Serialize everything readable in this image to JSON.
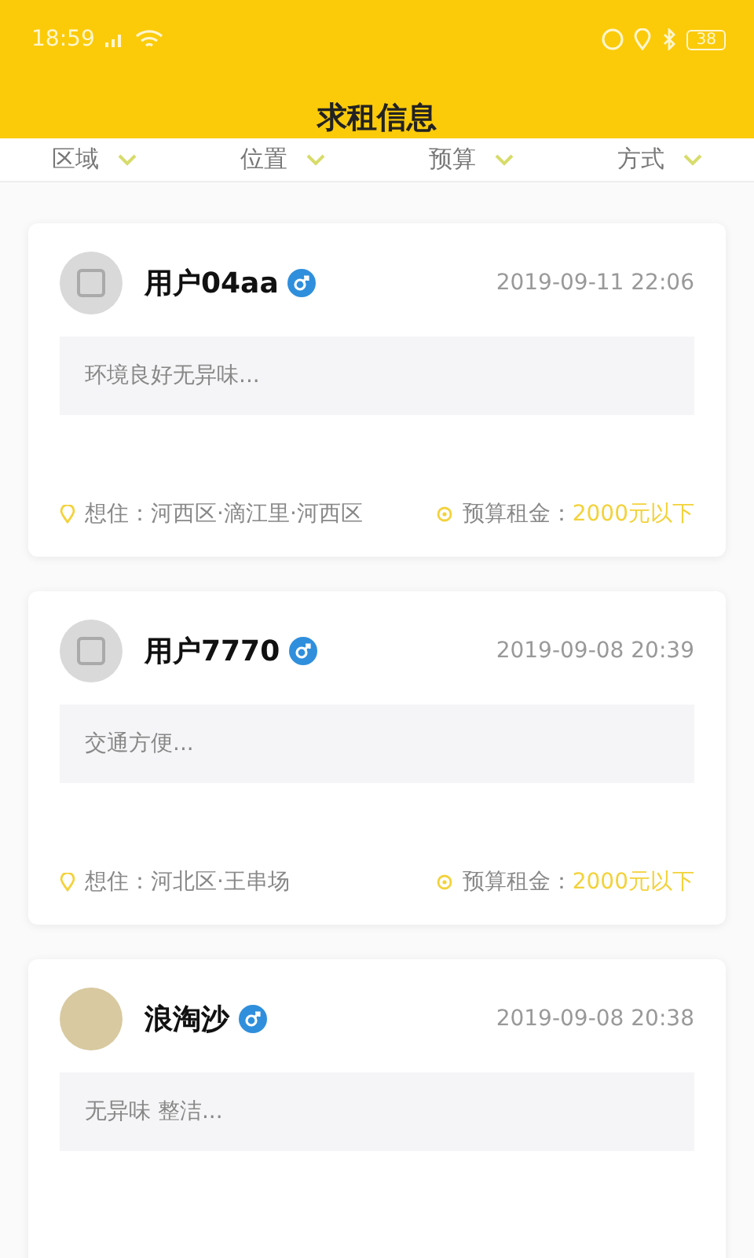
{
  "status_bar": {
    "time": "18:59",
    "battery": "38"
  },
  "header": {
    "title": "求租信息"
  },
  "filters": [
    {
      "label": "区域"
    },
    {
      "label": "位置"
    },
    {
      "label": "预算"
    },
    {
      "label": "方式"
    }
  ],
  "posts": [
    {
      "user": "用户04aa",
      "avatar": {
        "kind": "default"
      },
      "gender_badge": {
        "kind": "male"
      },
      "time": "2019-09-11 22:06",
      "description": "环境良好无异味...",
      "location_label": "想住：",
      "location": "河西区·滴江里·河西区",
      "budget_label": "预算租金：",
      "budget": "2000元以下"
    },
    {
      "user": "用户7770",
      "avatar": {
        "kind": "default"
      },
      "gender_badge": {
        "kind": "male"
      },
      "time": "2019-09-08 20:39",
      "description": "交通方便...",
      "location_label": "想住：",
      "location": "河北区·王串场",
      "budget_label": "预算租金：",
      "budget": "2000元以下"
    },
    {
      "user": "浪淘沙",
      "avatar": {
        "kind": "photo"
      },
      "gender_badge": {
        "kind": "male"
      },
      "time": "2019-09-08 20:38",
      "description": "无异味 整洁..."
    }
  ]
}
